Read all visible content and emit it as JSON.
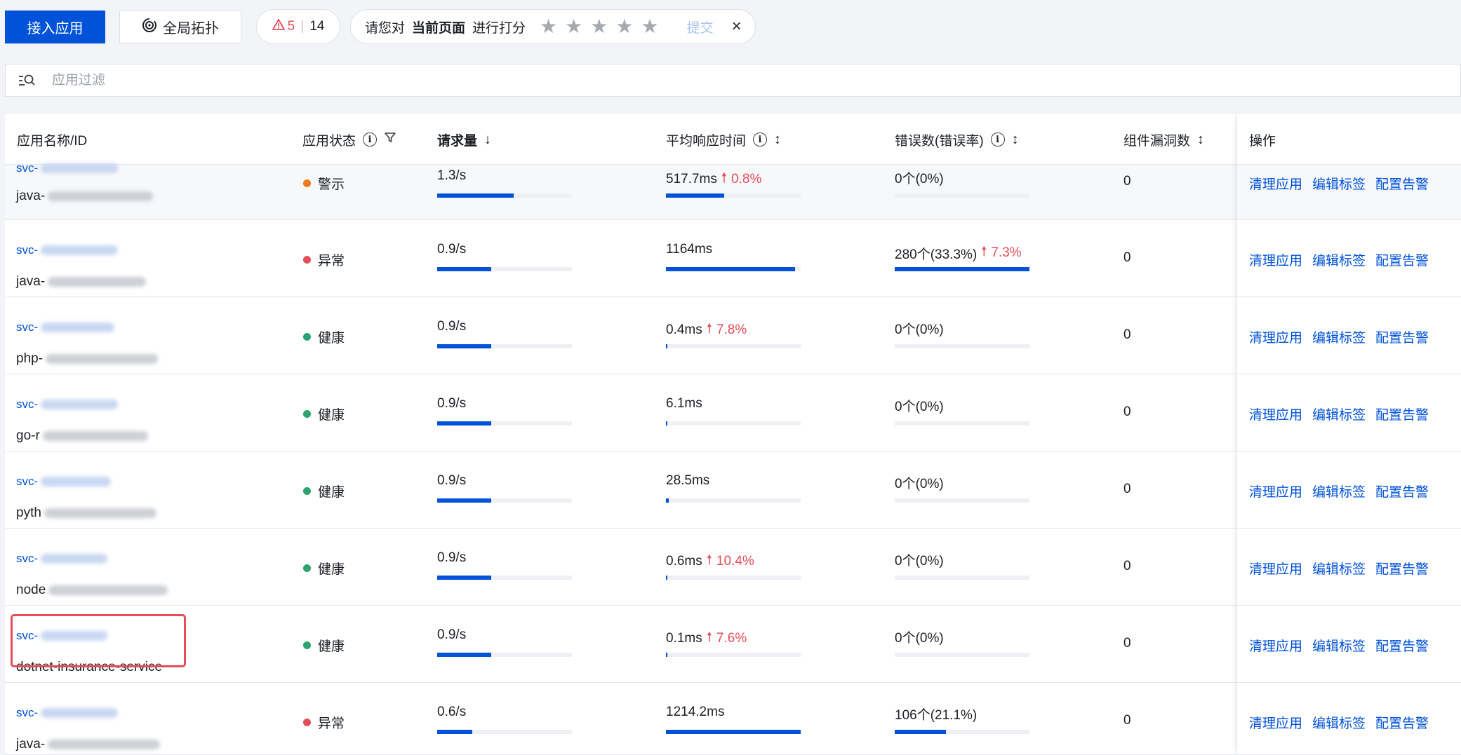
{
  "toolbar": {
    "connect_app": "接入应用",
    "topology": "全局拓扑",
    "alert_count": "5",
    "total_count": "14",
    "rating_prompt_prefix": "请您对",
    "rating_prompt_strong": "当前页面",
    "rating_prompt_suffix": "进行打分",
    "submit": "提交",
    "close": "×"
  },
  "filter": {
    "placeholder": "应用过滤"
  },
  "columns": {
    "app": "应用名称/ID",
    "status": "应用状态",
    "requests": "请求量",
    "latency": "平均响应时间",
    "errors": "错误数(错误率)",
    "vulns": "组件漏洞数",
    "ops": "操作"
  },
  "actions": {
    "clean": "清理应用",
    "edit_tags": "编辑标签",
    "alerts": "配置告警"
  },
  "status_colors": {
    "警示": "#f07a1a",
    "异常": "#e34d59",
    "健康": "#2ba471"
  },
  "rows": [
    {
      "id_prefix": "svc-",
      "name_prefix": "java-",
      "status": "警示",
      "req": "1.3/s",
      "req_pct": 0.57,
      "lat": "517.7ms",
      "lat_trend": "0.8%",
      "lat_pct": 0.43,
      "err": "0个(0%)",
      "err_trend": "",
      "err_pct": 0,
      "vulns": "0"
    },
    {
      "id_prefix": "svc-",
      "name_prefix": "java-",
      "status": "异常",
      "req": "0.9/s",
      "req_pct": 0.4,
      "lat": "1164ms",
      "lat_trend": "",
      "lat_pct": 0.96,
      "err": "280个(33.3%)",
      "err_trend": "7.3%",
      "err_pct": 1.0,
      "vulns": "0"
    },
    {
      "id_prefix": "svc-",
      "name_prefix": "php-",
      "status": "健康",
      "req": "0.9/s",
      "req_pct": 0.4,
      "lat": "0.4ms",
      "lat_trend": "7.8%",
      "lat_pct": 0.01,
      "err": "0个(0%)",
      "err_trend": "",
      "err_pct": 0,
      "vulns": "0"
    },
    {
      "id_prefix": "svc-",
      "name_prefix": "go-r",
      "status": "健康",
      "req": "0.9/s",
      "req_pct": 0.4,
      "lat": "6.1ms",
      "lat_trend": "",
      "lat_pct": 0.01,
      "err": "0个(0%)",
      "err_trend": "",
      "err_pct": 0,
      "vulns": "0"
    },
    {
      "id_prefix": "svc-",
      "name_prefix": "pyth",
      "status": "健康",
      "req": "0.9/s",
      "req_pct": 0.4,
      "lat": "28.5ms",
      "lat_trend": "",
      "lat_pct": 0.02,
      "err": "0个(0%)",
      "err_trend": "",
      "err_pct": 0,
      "vulns": "0"
    },
    {
      "id_prefix": "svc-",
      "name_prefix": "node",
      "status": "健康",
      "req": "0.9/s",
      "req_pct": 0.4,
      "lat": "0.6ms",
      "lat_trend": "10.4%",
      "lat_pct": 0.01,
      "err": "0个(0%)",
      "err_trend": "",
      "err_pct": 0,
      "vulns": "0"
    },
    {
      "id_prefix": "svc-",
      "name_prefix": "dotnet-insurance-service",
      "status": "健康",
      "req": "0.9/s",
      "req_pct": 0.4,
      "lat": "0.1ms",
      "lat_trend": "7.6%",
      "lat_pct": 0.0,
      "err": "0个(0%)",
      "err_trend": "",
      "err_pct": 0,
      "vulns": "0"
    },
    {
      "id_prefix": "svc-",
      "name_prefix": "java-",
      "status": "异常",
      "req": "0.6/s",
      "req_pct": 0.26,
      "lat": "1214.2ms",
      "lat_trend": "",
      "lat_pct": 1.0,
      "err": "106个(21.1%)",
      "err_trend": "",
      "err_pct": 0.38,
      "vulns": "0"
    }
  ]
}
